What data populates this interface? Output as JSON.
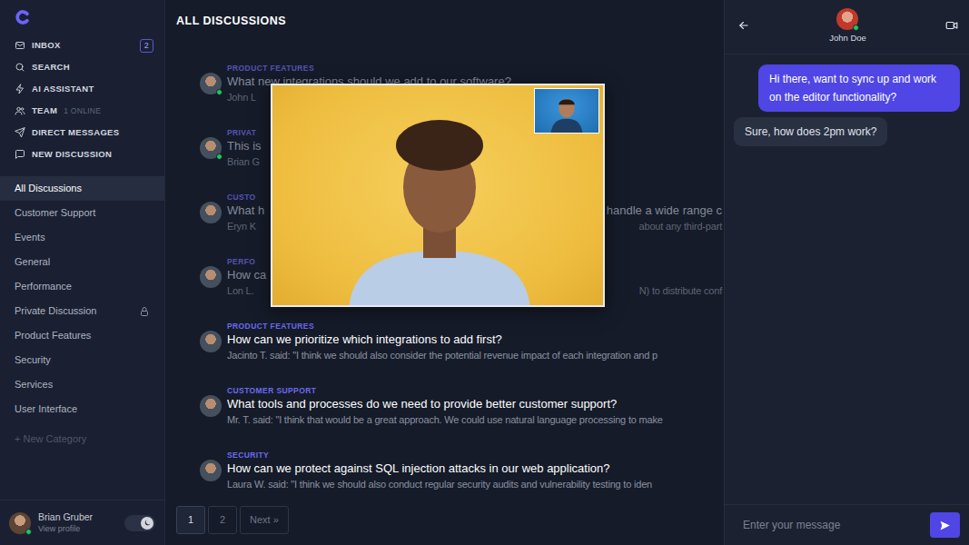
{
  "sidebar": {
    "nav": [
      {
        "label": "INBOX",
        "badge": "2"
      },
      {
        "label": "SEARCH"
      },
      {
        "label": "AI ASSISTANT"
      },
      {
        "label": "TEAM",
        "note": "1 ONLINE"
      },
      {
        "label": "DIRECT MESSAGES"
      },
      {
        "label": "NEW DISCUSSION"
      }
    ],
    "categories": [
      {
        "label": "All Discussions",
        "selected": true,
        "locked": false
      },
      {
        "label": "Customer Support",
        "selected": false,
        "locked": false
      },
      {
        "label": "Events",
        "selected": false,
        "locked": false
      },
      {
        "label": "General",
        "selected": false,
        "locked": false
      },
      {
        "label": "Performance",
        "selected": false,
        "locked": false
      },
      {
        "label": "Private Discussion",
        "selected": false,
        "locked": true
      },
      {
        "label": "Product Features",
        "selected": false,
        "locked": false
      },
      {
        "label": "Security",
        "selected": false,
        "locked": false
      },
      {
        "label": "Services",
        "selected": false,
        "locked": false
      },
      {
        "label": "User Interface",
        "selected": false,
        "locked": false
      }
    ],
    "new_category": {
      "label": "+ New Category",
      "disabled": true
    },
    "user": {
      "name": "Brian Gruber",
      "link": "View profile",
      "online": true
    },
    "dark_mode": true
  },
  "main": {
    "title": "ALL DISCUSSIONS",
    "discussions": [
      {
        "category": "PRODUCT FEATURES",
        "title": "What new integrations should we add to our software?",
        "title_tail": "",
        "excerpt": "John L",
        "excerpt_tail": "",
        "faded": true,
        "online": true
      },
      {
        "category": "PRIVAT",
        "title": "This is",
        "title_tail": "",
        "excerpt": "Brian G",
        "excerpt_tail": "",
        "faded": true,
        "online": true
      },
      {
        "category": "CUSTO",
        "title": "What h",
        "title_tail": "handle a wide range c",
        "excerpt": "Eryn K",
        "excerpt_tail": "about any third-part",
        "faded": true,
        "online": false
      },
      {
        "category": "PERFO",
        "title": "How ca",
        "title_tail": "",
        "excerpt": "Lon L.",
        "excerpt_tail": "N) to distribute conf",
        "faded": true,
        "online": false
      },
      {
        "category": "PRODUCT FEATURES",
        "title": "How can we prioritize which integrations to add first?",
        "title_tail": "",
        "excerpt": "Jacinto T. said: \"I think we should also consider the potential revenue impact of each integration and p",
        "excerpt_tail": "",
        "faded": false,
        "online": false
      },
      {
        "category": "CUSTOMER SUPPORT",
        "title": "What tools and processes do we need to provide better customer support?",
        "title_tail": "",
        "excerpt": "Mr. T. said: \"I think that would be a great approach. We could use natural language processing to make",
        "excerpt_tail": "",
        "faded": false,
        "online": false
      },
      {
        "category": "SECURITY",
        "title": "How can we protect against SQL injection attacks in our web application?",
        "title_tail": "",
        "excerpt": "Laura W. said: \"I think we should also conduct regular security audits and vulnerability testing to iden",
        "excerpt_tail": "",
        "faded": false,
        "online": false
      }
    ],
    "pagination": [
      {
        "label": "1",
        "selected": true
      },
      {
        "label": "2",
        "selected": false
      },
      {
        "label": "Next »",
        "selected": false
      }
    ]
  },
  "chat": {
    "contact": {
      "name": "John Doe",
      "online": true
    },
    "messages": [
      {
        "text": "Hi there, want to sync up and work on the editor functionality?",
        "mine": true
      },
      {
        "text": "Sure, how does 2pm work?",
        "mine": false
      }
    ],
    "input": {
      "placeholder": "Enter your message"
    }
  }
}
